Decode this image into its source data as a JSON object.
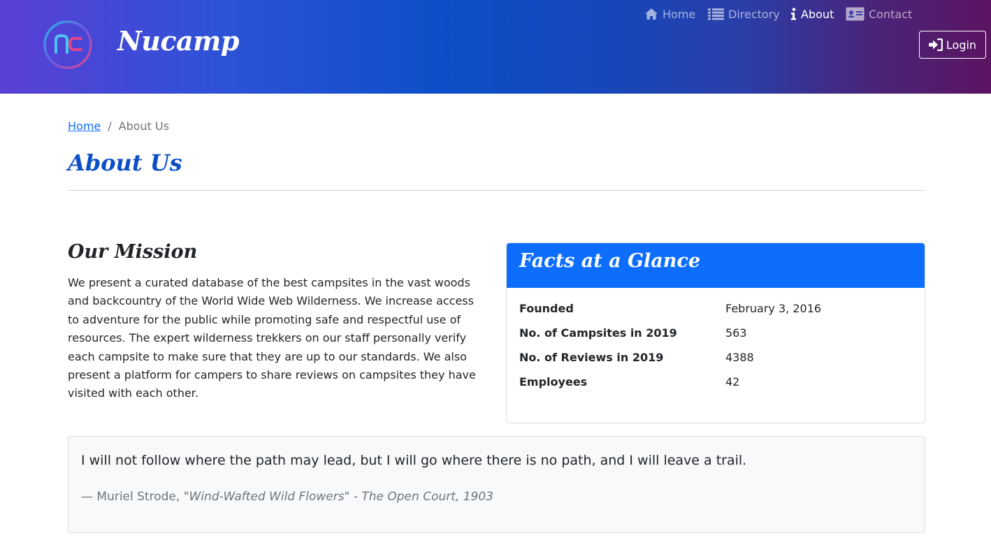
{
  "brand": {
    "name": "Nucamp"
  },
  "nav": {
    "items": [
      {
        "label": "Home",
        "icon": "home-icon",
        "active": false
      },
      {
        "label": "Directory",
        "icon": "list-icon",
        "active": false
      },
      {
        "label": "About",
        "icon": "info-icon",
        "active": true
      },
      {
        "label": "Contact",
        "icon": "address-card-icon",
        "active": false
      }
    ],
    "login_label": "Login"
  },
  "breadcrumb": {
    "home": "Home",
    "separator": "/",
    "current": "About Us"
  },
  "page": {
    "title": "About Us"
  },
  "mission": {
    "title": "Our Mission",
    "text": "We present a curated database of the best campsites in the vast woods and backcountry of the World Wide Web Wilderness. We increase access to adventure for the public while promoting safe and respectful use of resources. The expert wilderness trekkers on our staff personally verify each campsite to make sure that they are up to our standards. We also present a platform for campers to share reviews on campsites they have visited with each other."
  },
  "facts": {
    "title": "Facts at a Glance",
    "rows": [
      {
        "label": "Founded",
        "value": "February 3, 2016"
      },
      {
        "label": "No. of Campsites in 2019",
        "value": "563"
      },
      {
        "label": "No. of Reviews in 2019",
        "value": "4388"
      },
      {
        "label": "Employees",
        "value": "42"
      }
    ]
  },
  "quote": {
    "text": "I will not follow where the path may lead, but I will go where there is no path, and I will leave a trail.",
    "author": "— Muriel Strode, ",
    "source": "\"Wind-Wafted Wild Flowers\" - The Open Court, 1903"
  },
  "colors": {
    "primary": "#0d6efd",
    "title_blue": "#0b4fc7",
    "muted": "#6c757d"
  }
}
